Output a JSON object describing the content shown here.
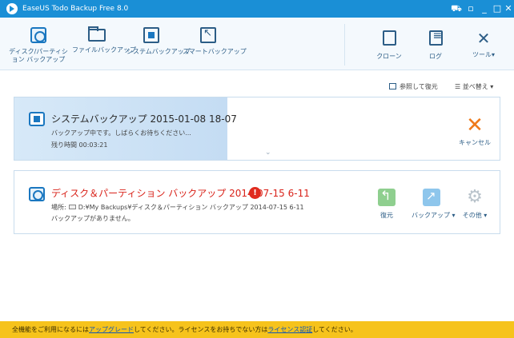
{
  "titlebar": {
    "title": "EaseUS Todo Backup Free 8.0",
    "controls": [
      "cart-icon",
      "restore-icon",
      "minimize-icon",
      "maximize-icon",
      "close-icon"
    ]
  },
  "toolbar": {
    "left": [
      {
        "label": "ディスク/パーティション バックアップ",
        "icon": "disk-backup-icon"
      },
      {
        "label": "ファイルバックアップ",
        "icon": "folder-icon"
      },
      {
        "label": "システムバックアップ",
        "icon": "windows-icon"
      },
      {
        "label": "スマートバックアップ",
        "icon": "smart-backup-icon"
      }
    ],
    "right": [
      {
        "label": "クローン",
        "icon": "clone-icon"
      },
      {
        "label": "ログ",
        "icon": "log-icon"
      },
      {
        "label": "ツール",
        "icon": "tools-icon"
      }
    ]
  },
  "sortbar": {
    "browse_label": "参照して復元",
    "sort_label": "並べ替え"
  },
  "tasks": [
    {
      "title": "システムバックアップ 2015-01-08 18-07",
      "status": "バックアップ中です。しばらくお待ちください...",
      "remaining_label": "残り時間",
      "remaining_value": "00:03:21",
      "cancel_label": "キャンセル",
      "accent_color": "#ef7a1a"
    },
    {
      "title": "ディスク＆パーティション バックアップ 2014-07-15 6-11",
      "location_label": "場所:",
      "location_path": "D:¥My Backups¥ディスク＆パーティション バックアップ 2014-07-15 6-11",
      "message": "バックアップがありません。",
      "title_color": "#d9231a",
      "actions": [
        {
          "label": "復元",
          "icon": "restore-icon"
        },
        {
          "label": "バックアップ",
          "icon": "backup-icon"
        },
        {
          "label": "その他",
          "icon": "gear-icon"
        }
      ]
    }
  ],
  "footer": {
    "text1": "全機能をご利用になるには",
    "link1": "アップグレード",
    "text2": "してください。ライセンスをお持ちでない方は",
    "link2": "ライセンス認証",
    "text3": "してください。"
  }
}
